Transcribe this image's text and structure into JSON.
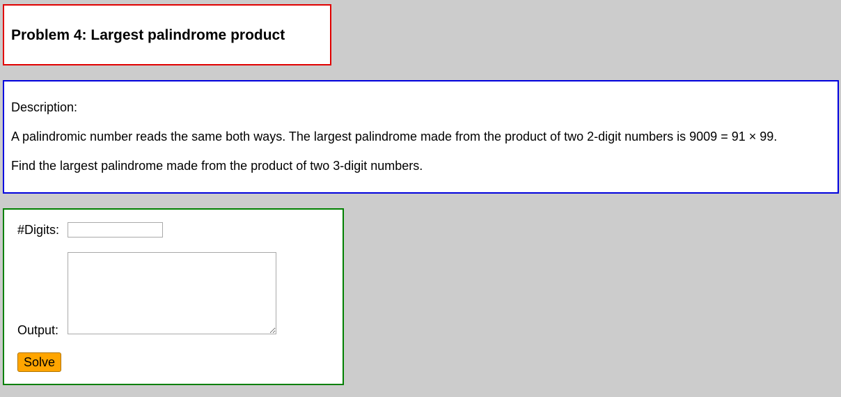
{
  "title": "Problem 4: Largest palindrome product",
  "description": {
    "heading": "Description:",
    "paragraph1": "A palindromic number reads the same both ways. The largest palindrome made from the product of two 2-digit numbers is 9009 = 91 × 99.",
    "paragraph2": "Find the largest palindrome made from the product of two 3-digit numbers."
  },
  "form": {
    "digits_label": "#Digits:",
    "digits_value": "",
    "output_label": "Output:",
    "output_value": "",
    "solve_label": "Solve"
  },
  "colors": {
    "background": "#cccccc",
    "title_border": "#e00000",
    "description_border": "#0000dd",
    "form_border": "#008000",
    "button": "#ffa500"
  }
}
